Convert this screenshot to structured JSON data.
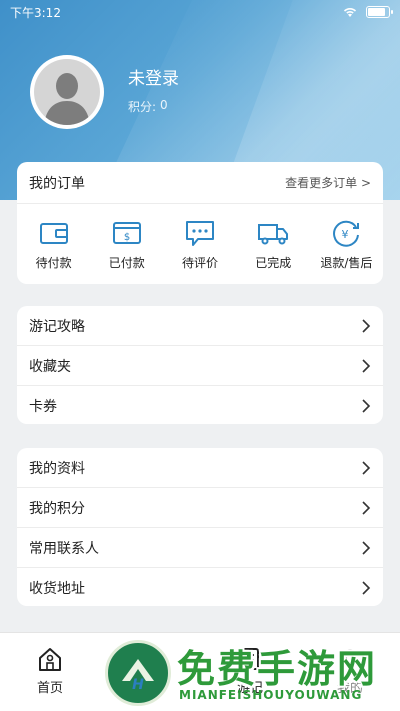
{
  "status_bar": {
    "time": "下午3:12"
  },
  "profile": {
    "name": "未登录",
    "points_label": "积分:",
    "points_value": "0"
  },
  "orders": {
    "title": "我的订单",
    "more_label": "查看更多订单 >",
    "items": [
      {
        "icon": "wallet-icon",
        "label": "待付款"
      },
      {
        "icon": "card-paid-icon",
        "label": "已付款"
      },
      {
        "icon": "comment-icon",
        "label": "待评价"
      },
      {
        "icon": "truck-icon",
        "label": "已完成"
      },
      {
        "icon": "refund-icon",
        "label": "退款/售后"
      }
    ]
  },
  "menu_group1": [
    {
      "label": "游记攻略"
    },
    {
      "label": "收藏夹"
    },
    {
      "label": "卡券"
    }
  ],
  "menu_group2": [
    {
      "label": "我的资料"
    },
    {
      "label": "我的积分"
    },
    {
      "label": "常用联系人"
    },
    {
      "label": "收货地址"
    }
  ],
  "tabbar": [
    {
      "icon": "home-icon",
      "label": "首页"
    },
    {
      "icon": "discover-icon",
      "label": ""
    },
    {
      "icon": "travel-note-icon",
      "label": "游记"
    },
    {
      "icon": "profile-icon",
      "label": "我的"
    }
  ],
  "watermark": {
    "title": "免费手游网",
    "subtitle": "MIANFEISHOUYOUWANG"
  },
  "colors": {
    "header_blue": "#3f90c9",
    "background": "#eef0f2",
    "watermark_green": "#2e9a3a"
  }
}
